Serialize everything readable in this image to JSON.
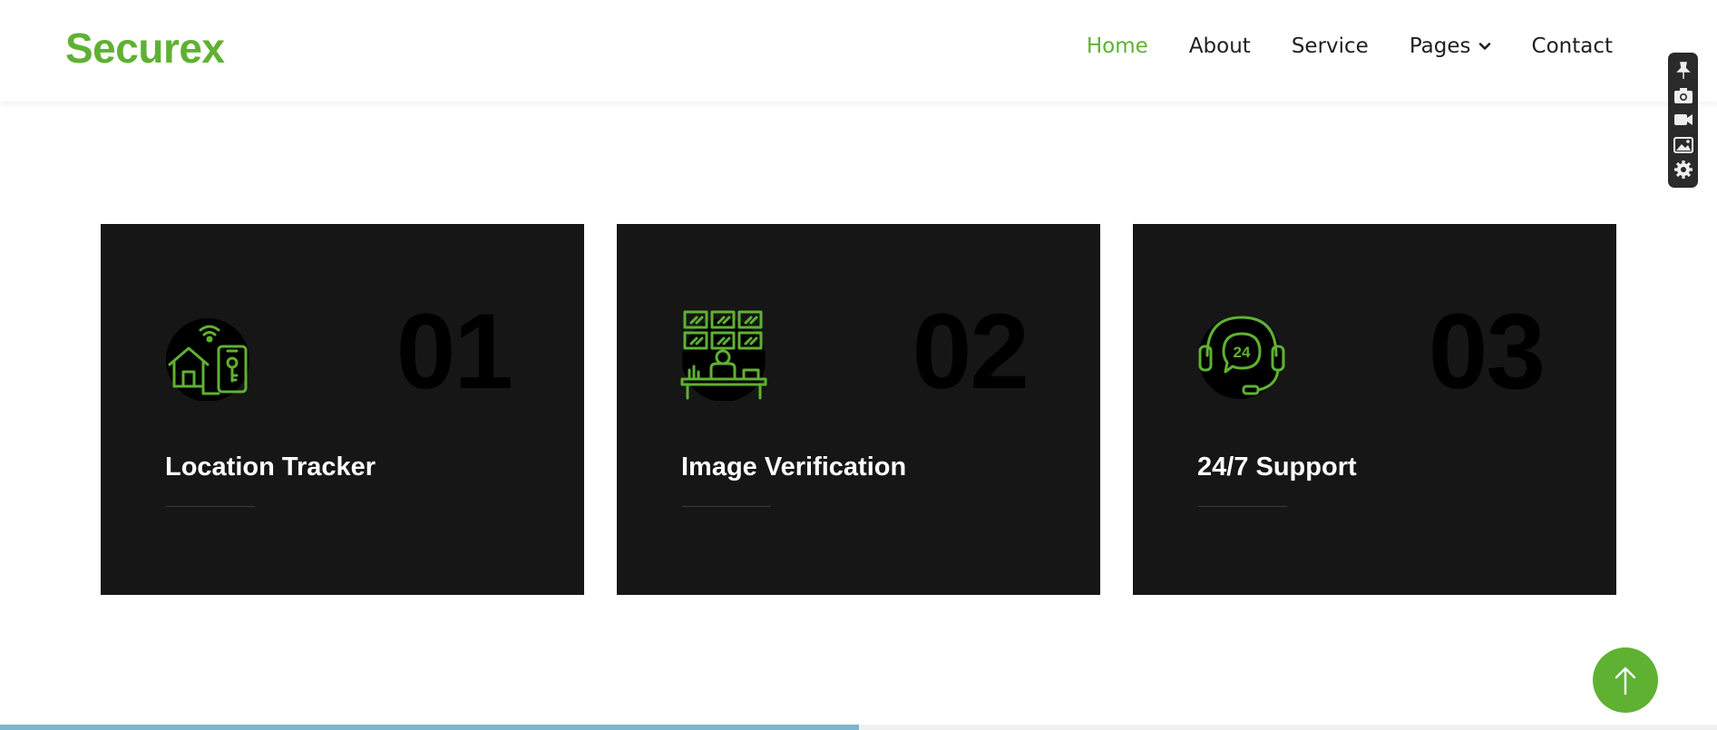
{
  "brand": {
    "name": "Securex",
    "color": "#5fb132"
  },
  "nav": {
    "items": [
      {
        "label": "Home",
        "active": true
      },
      {
        "label": "About",
        "active": false
      },
      {
        "label": "Service",
        "active": false
      },
      {
        "label": "Pages",
        "active": false,
        "has_dropdown": true
      },
      {
        "label": "Contact",
        "active": false
      }
    ]
  },
  "tool_panel": {
    "tools": [
      "pin-icon",
      "camera-icon",
      "video-icon",
      "gallery-icon",
      "settings-icon"
    ]
  },
  "cards": [
    {
      "number": "01",
      "title": "Location Tracker",
      "icon": "smart-home-icon"
    },
    {
      "number": "02",
      "title": "Image Verification",
      "icon": "surveillance-monitor-icon"
    },
    {
      "number": "03",
      "title": "24/7 Support",
      "icon": "support-headset-icon"
    }
  ],
  "colors": {
    "accent": "#5fb132",
    "card_bg": "#161616",
    "progress": "#7cb6ce"
  },
  "scroll_progress": 0.5
}
